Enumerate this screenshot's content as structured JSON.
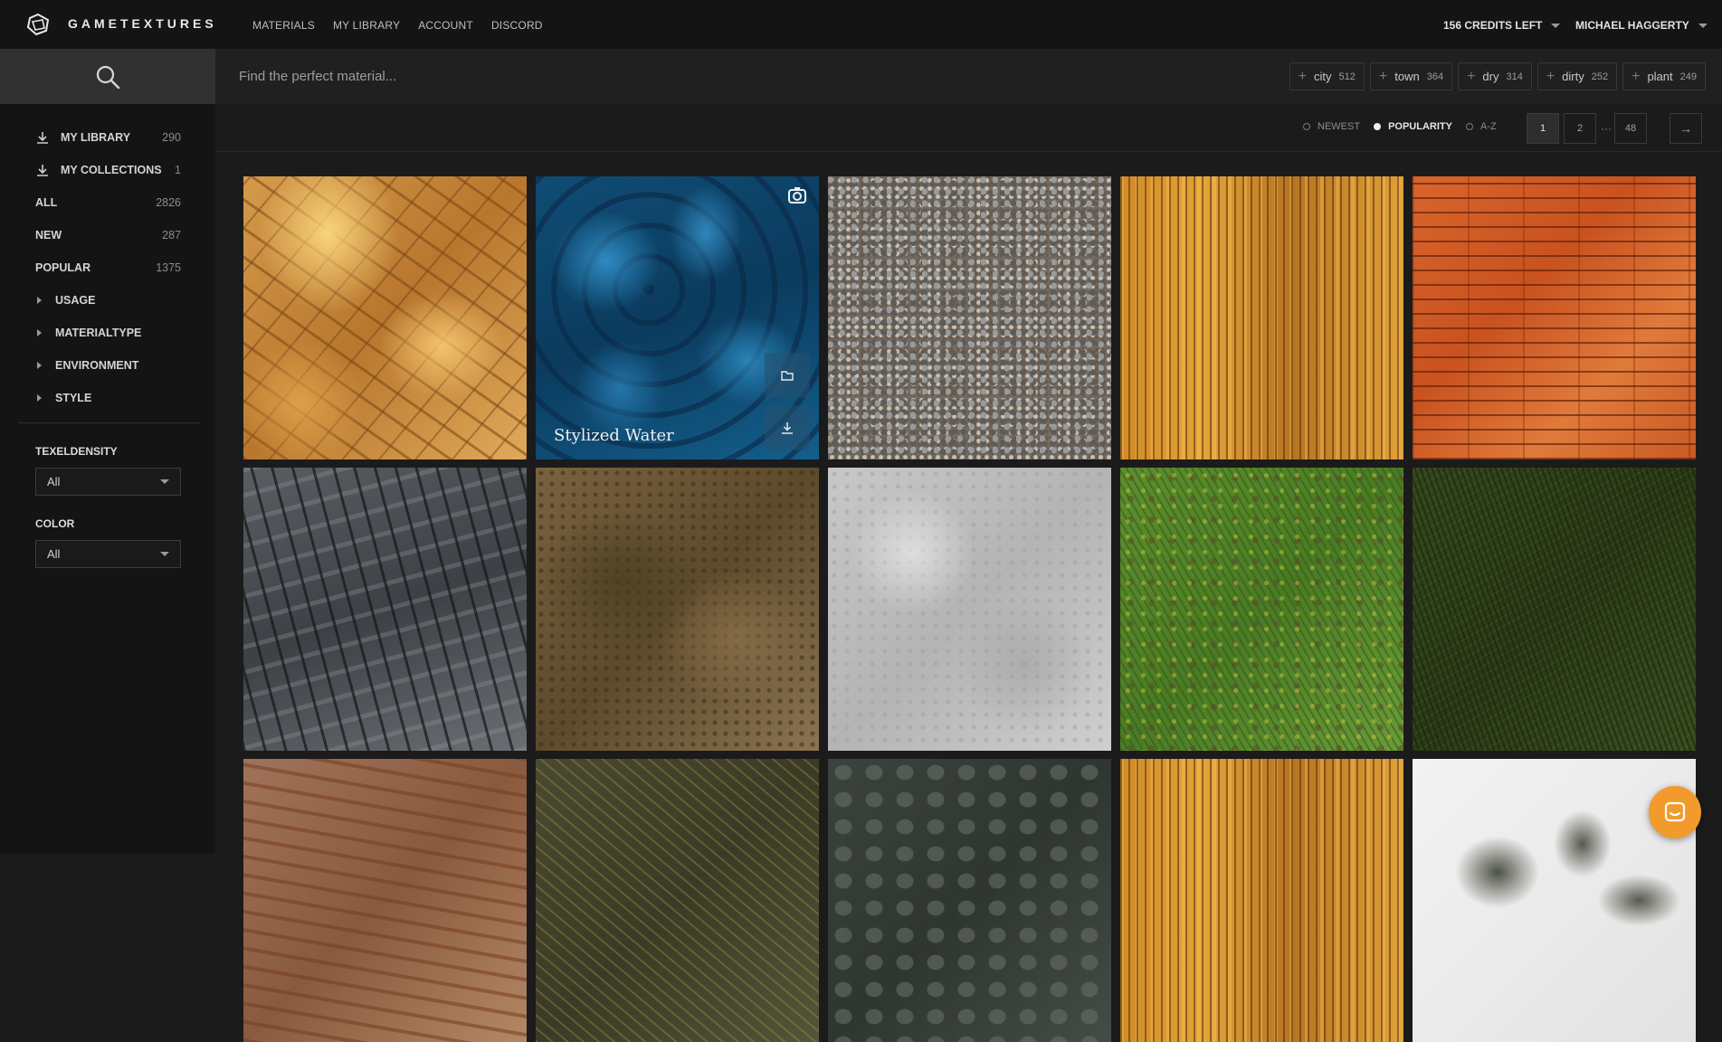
{
  "brand": {
    "name": "GAMETEXTURES",
    "logo_icon": "gametextures-logo-icon"
  },
  "nav": [
    {
      "label": "MATERIALS"
    },
    {
      "label": "MY LIBRARY"
    },
    {
      "label": "ACCOUNT"
    },
    {
      "label": "DISCORD"
    }
  ],
  "account": {
    "credits": "156 CREDITS LEFT",
    "user": "MICHAEL HAGGERTY"
  },
  "search": {
    "placeholder": "Find the perfect material...",
    "icon": "search-icon"
  },
  "tags": [
    {
      "label": "city",
      "count": "512"
    },
    {
      "label": "town",
      "count": "364"
    },
    {
      "label": "dry",
      "count": "314"
    },
    {
      "label": "dirty",
      "count": "252"
    },
    {
      "label": "plant",
      "count": "249"
    }
  ],
  "sidebar": {
    "items": [
      {
        "label": "MY LIBRARY",
        "count": "290",
        "icon": "download-icon"
      },
      {
        "label": "MY COLLECTIONS",
        "count": "1",
        "icon": "download-icon"
      },
      {
        "label": "ALL",
        "count": "2826"
      },
      {
        "label": "NEW",
        "count": "287"
      },
      {
        "label": "POPULAR",
        "count": "1375"
      }
    ],
    "expandable": [
      {
        "label": "USAGE"
      },
      {
        "label": "MATERIALTYPE"
      },
      {
        "label": "ENVIRONMENT"
      },
      {
        "label": "STYLE"
      }
    ],
    "filters": [
      {
        "label": "TEXELDENSITY",
        "value": "All"
      },
      {
        "label": "COLOR",
        "value": "All"
      }
    ]
  },
  "sort": {
    "options": [
      {
        "label": "NEWEST",
        "active": false
      },
      {
        "label": "POPULARITY",
        "active": true
      },
      {
        "label": "A-Z",
        "active": false
      }
    ]
  },
  "pagination": {
    "pages": [
      "1",
      "2",
      "48"
    ],
    "ellipsis": "···",
    "current": "1",
    "next": "→"
  },
  "materials": [
    {
      "texture": "gold"
    },
    {
      "texture": "water",
      "title": "Stylized Water",
      "hover": true,
      "badge_icon": "substance-icon",
      "actions": [
        "folder-icon",
        "download-icon"
      ]
    },
    {
      "texture": "gravel"
    },
    {
      "texture": "woodplank"
    },
    {
      "texture": "floor"
    },
    {
      "texture": "slate"
    },
    {
      "texture": "dirt"
    },
    {
      "texture": "plaster"
    },
    {
      "texture": "grass"
    },
    {
      "texture": "darkgrass"
    },
    {
      "texture": "rockred"
    },
    {
      "texture": "forest"
    },
    {
      "texture": "stones"
    },
    {
      "texture": "woodplank"
    },
    {
      "texture": "snow"
    }
  ],
  "colors": {
    "accent_chat": "#f39a2c",
    "background": "#1b1b1b",
    "sidebar": "#141414"
  },
  "chat": {
    "icon": "chat-icon"
  }
}
